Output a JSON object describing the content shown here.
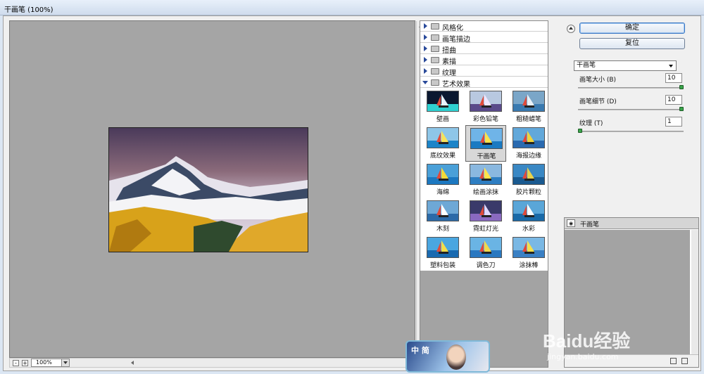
{
  "window": {
    "title": "干画笔 (100%)"
  },
  "preview": {
    "zoom": "100%",
    "zoom_minus": "-",
    "zoom_plus": "+"
  },
  "gallery": {
    "categories": [
      {
        "label": "风格化",
        "expanded": false
      },
      {
        "label": "画笔描边",
        "expanded": false
      },
      {
        "label": "扭曲",
        "expanded": false
      },
      {
        "label": "素描",
        "expanded": false
      },
      {
        "label": "纹理",
        "expanded": false
      },
      {
        "label": "艺术效果",
        "expanded": true
      }
    ],
    "filters": [
      "壁画",
      "彩色铅笔",
      "粗糙蜡笔",
      "底纹效果",
      "干画笔",
      "海报边缘",
      "海绵",
      "绘画涂抹",
      "胶片颗粒",
      "木刻",
      "霓虹灯光",
      "水彩",
      "塑料包装",
      "调色刀",
      "涂抹棒"
    ],
    "selected": "干画笔"
  },
  "settings": {
    "ok_label": "确定",
    "reset_label": "复位",
    "filter_select": "干画笔",
    "params": [
      {
        "label": "画笔大小 (B)",
        "value": "10",
        "fraction": 1.0
      },
      {
        "label": "画笔细节 (D)",
        "value": "10",
        "fraction": 1.0
      },
      {
        "label": "纹理 (T)",
        "value": "1",
        "fraction": 0.0
      }
    ]
  },
  "layers": {
    "items": [
      {
        "name": "干画笔"
      }
    ]
  },
  "watermark": {
    "big": "Baidu经验",
    "small": "jingyan.baidu.com"
  },
  "avatar": {
    "text": "中 简"
  },
  "colors": {
    "preview_bg": "#a5a5a5",
    "accent_knob": "#3aa44a",
    "ok_border": "#3b78c4"
  }
}
